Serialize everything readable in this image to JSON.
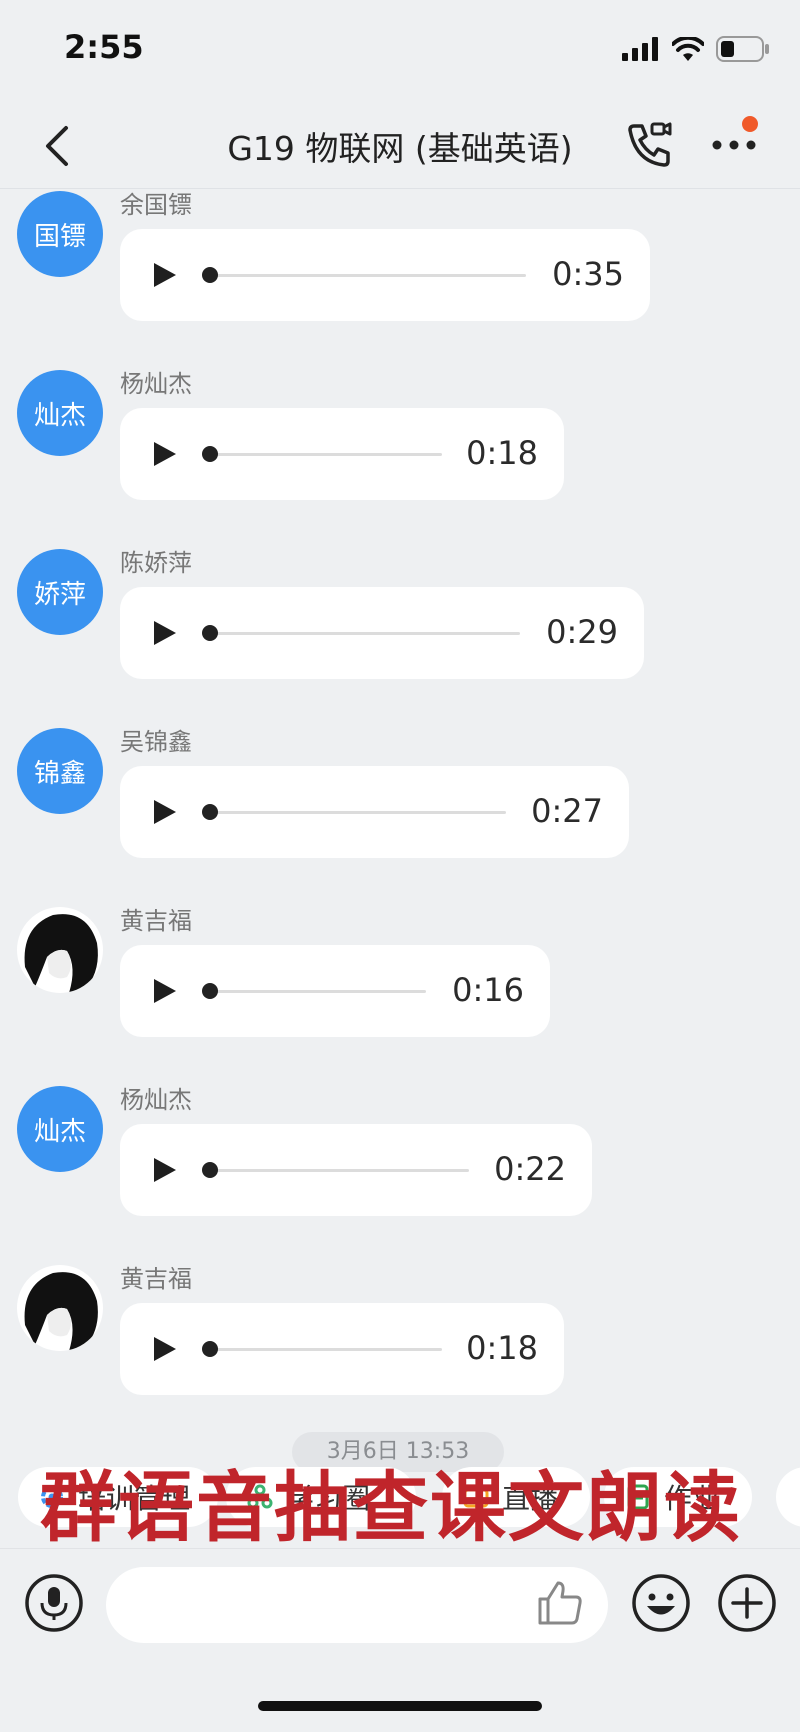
{
  "status_bar": {
    "time": "2:55",
    "icons": [
      "signal-icon",
      "wifi-icon",
      "battery-icon"
    ]
  },
  "header": {
    "title": "G19 物联网 (基础英语)",
    "accent": "#f05a2a"
  },
  "messages": [
    {
      "sender": "余国镖",
      "avatar_text": "国镖",
      "duration": "0:35"
    },
    {
      "sender": "杨灿杰",
      "avatar_text": "灿杰",
      "duration": "0:18"
    },
    {
      "sender": "陈娇萍",
      "avatar_text": "娇萍",
      "duration": "0:29"
    },
    {
      "sender": "吴锦鑫",
      "avatar_text": "锦鑫",
      "duration": "0:27"
    },
    {
      "sender": "黄吉福",
      "avatar_text": "",
      "duration": "0:16"
    },
    {
      "sender": "杨灿杰",
      "avatar_text": "灿杰",
      "duration": "0:22"
    },
    {
      "sender": "黄吉福",
      "avatar_text": "",
      "duration": "0:18"
    }
  ],
  "date_divider": "3月6日 13:53",
  "quick_actions": [
    {
      "label": "培训管理",
      "icon": "gear-icon",
      "color": "#3a93f0"
    },
    {
      "label": "学习圈",
      "icon": "recycle-icon",
      "color": "#3cb371"
    },
    {
      "label": "直播",
      "icon": "live-icon",
      "color": "#f5a623"
    },
    {
      "label": "作业",
      "icon": "homework-icon",
      "color": "#2ea44f"
    }
  ],
  "overlay_caption": "群语音抽查课文朗读",
  "composer": {
    "placeholder": ""
  },
  "colors": {
    "avatar_blue": "#3a93f0",
    "background": "#eef0f2",
    "overlay_red": "#c0252b"
  }
}
